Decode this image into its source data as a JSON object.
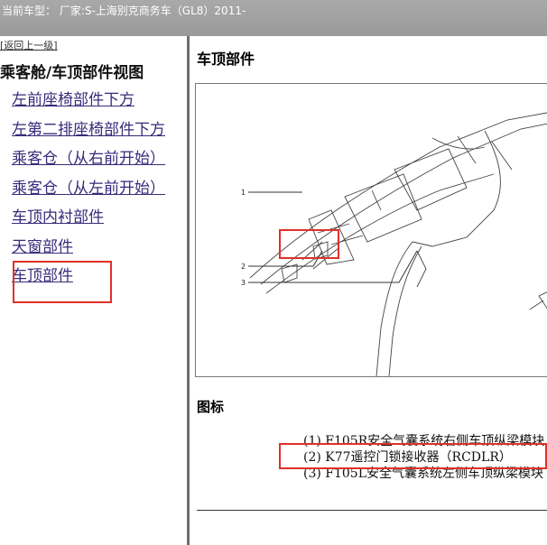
{
  "header": {
    "text": "当前车型： 厂家:S-上海别克商务车（GL8）2011-"
  },
  "nav": {
    "back_label": "[返回上一级]",
    "title": "乘客舱/车顶部件视图",
    "items": [
      {
        "label": "左前座椅部件下方"
      },
      {
        "label": "左第二排座椅部件下方"
      },
      {
        "label": "乘客仓（从右前开始）"
      },
      {
        "label": "乘客仓（从左前开始）"
      },
      {
        "label": "车顶内衬部件"
      },
      {
        "label": "天窗部件"
      },
      {
        "label": "车顶部件"
      }
    ]
  },
  "main": {
    "title": "车顶部件",
    "figure_callouts": [
      "1",
      "2",
      "3"
    ],
    "legend_title": "图标",
    "legend": [
      {
        "label": "(1) F105R安全气囊系统右侧车顶纵梁模块"
      },
      {
        "label": "(2) K77遥控门锁接收器（RCDLR）"
      },
      {
        "label": "(3) F105L安全气囊系统左侧车顶纵梁模块"
      }
    ]
  },
  "colors": {
    "header_bg": "#a9a9a9",
    "link": "#3a2a7a",
    "highlight": "#e0302a",
    "divider": "#6e6e6e"
  }
}
